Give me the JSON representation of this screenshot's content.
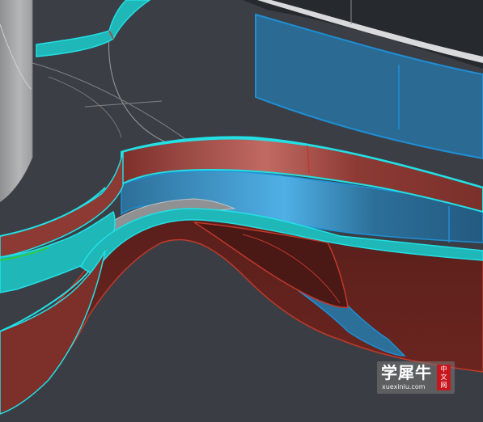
{
  "scene": {
    "colors": {
      "background": "#3b3f45",
      "wall_gray": "#a9abac",
      "blue_panel": "#2c6f99",
      "blue_highlight": "#4fb0e6",
      "red_surface": "#8d3a34",
      "dark_red": "#5a1f1b",
      "cyan_edge": "#22e0e6",
      "teal_band": "#1fb7b7"
    }
  },
  "watermark": {
    "brand": "学犀牛",
    "url": "xuexiniu.com",
    "badge_line1": "中",
    "badge_line2": "文",
    "badge_line3": "网"
  }
}
